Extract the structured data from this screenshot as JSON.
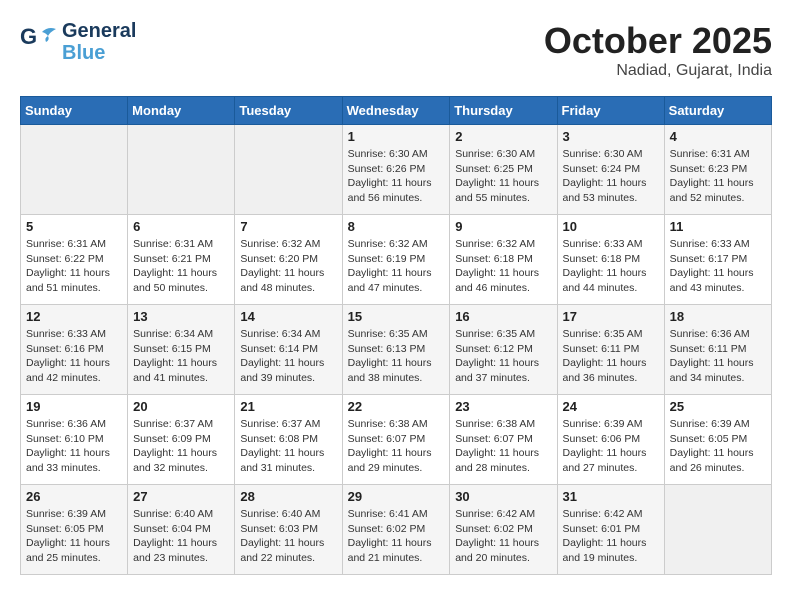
{
  "logo": {
    "line1": "General",
    "line2": "Blue"
  },
  "title": "October 2025",
  "location": "Nadiad, Gujarat, India",
  "days_of_week": [
    "Sunday",
    "Monday",
    "Tuesday",
    "Wednesday",
    "Thursday",
    "Friday",
    "Saturday"
  ],
  "weeks": [
    [
      {
        "day": "",
        "info": ""
      },
      {
        "day": "",
        "info": ""
      },
      {
        "day": "",
        "info": ""
      },
      {
        "day": "1",
        "info": "Sunrise: 6:30 AM\nSunset: 6:26 PM\nDaylight: 11 hours\nand 56 minutes."
      },
      {
        "day": "2",
        "info": "Sunrise: 6:30 AM\nSunset: 6:25 PM\nDaylight: 11 hours\nand 55 minutes."
      },
      {
        "day": "3",
        "info": "Sunrise: 6:30 AM\nSunset: 6:24 PM\nDaylight: 11 hours\nand 53 minutes."
      },
      {
        "day": "4",
        "info": "Sunrise: 6:31 AM\nSunset: 6:23 PM\nDaylight: 11 hours\nand 52 minutes."
      }
    ],
    [
      {
        "day": "5",
        "info": "Sunrise: 6:31 AM\nSunset: 6:22 PM\nDaylight: 11 hours\nand 51 minutes."
      },
      {
        "day": "6",
        "info": "Sunrise: 6:31 AM\nSunset: 6:21 PM\nDaylight: 11 hours\nand 50 minutes."
      },
      {
        "day": "7",
        "info": "Sunrise: 6:32 AM\nSunset: 6:20 PM\nDaylight: 11 hours\nand 48 minutes."
      },
      {
        "day": "8",
        "info": "Sunrise: 6:32 AM\nSunset: 6:19 PM\nDaylight: 11 hours\nand 47 minutes."
      },
      {
        "day": "9",
        "info": "Sunrise: 6:32 AM\nSunset: 6:18 PM\nDaylight: 11 hours\nand 46 minutes."
      },
      {
        "day": "10",
        "info": "Sunrise: 6:33 AM\nSunset: 6:18 PM\nDaylight: 11 hours\nand 44 minutes."
      },
      {
        "day": "11",
        "info": "Sunrise: 6:33 AM\nSunset: 6:17 PM\nDaylight: 11 hours\nand 43 minutes."
      }
    ],
    [
      {
        "day": "12",
        "info": "Sunrise: 6:33 AM\nSunset: 6:16 PM\nDaylight: 11 hours\nand 42 minutes."
      },
      {
        "day": "13",
        "info": "Sunrise: 6:34 AM\nSunset: 6:15 PM\nDaylight: 11 hours\nand 41 minutes."
      },
      {
        "day": "14",
        "info": "Sunrise: 6:34 AM\nSunset: 6:14 PM\nDaylight: 11 hours\nand 39 minutes."
      },
      {
        "day": "15",
        "info": "Sunrise: 6:35 AM\nSunset: 6:13 PM\nDaylight: 11 hours\nand 38 minutes."
      },
      {
        "day": "16",
        "info": "Sunrise: 6:35 AM\nSunset: 6:12 PM\nDaylight: 11 hours\nand 37 minutes."
      },
      {
        "day": "17",
        "info": "Sunrise: 6:35 AM\nSunset: 6:11 PM\nDaylight: 11 hours\nand 36 minutes."
      },
      {
        "day": "18",
        "info": "Sunrise: 6:36 AM\nSunset: 6:11 PM\nDaylight: 11 hours\nand 34 minutes."
      }
    ],
    [
      {
        "day": "19",
        "info": "Sunrise: 6:36 AM\nSunset: 6:10 PM\nDaylight: 11 hours\nand 33 minutes."
      },
      {
        "day": "20",
        "info": "Sunrise: 6:37 AM\nSunset: 6:09 PM\nDaylight: 11 hours\nand 32 minutes."
      },
      {
        "day": "21",
        "info": "Sunrise: 6:37 AM\nSunset: 6:08 PM\nDaylight: 11 hours\nand 31 minutes."
      },
      {
        "day": "22",
        "info": "Sunrise: 6:38 AM\nSunset: 6:07 PM\nDaylight: 11 hours\nand 29 minutes."
      },
      {
        "day": "23",
        "info": "Sunrise: 6:38 AM\nSunset: 6:07 PM\nDaylight: 11 hours\nand 28 minutes."
      },
      {
        "day": "24",
        "info": "Sunrise: 6:39 AM\nSunset: 6:06 PM\nDaylight: 11 hours\nand 27 minutes."
      },
      {
        "day": "25",
        "info": "Sunrise: 6:39 AM\nSunset: 6:05 PM\nDaylight: 11 hours\nand 26 minutes."
      }
    ],
    [
      {
        "day": "26",
        "info": "Sunrise: 6:39 AM\nSunset: 6:05 PM\nDaylight: 11 hours\nand 25 minutes."
      },
      {
        "day": "27",
        "info": "Sunrise: 6:40 AM\nSunset: 6:04 PM\nDaylight: 11 hours\nand 23 minutes."
      },
      {
        "day": "28",
        "info": "Sunrise: 6:40 AM\nSunset: 6:03 PM\nDaylight: 11 hours\nand 22 minutes."
      },
      {
        "day": "29",
        "info": "Sunrise: 6:41 AM\nSunset: 6:02 PM\nDaylight: 11 hours\nand 21 minutes."
      },
      {
        "day": "30",
        "info": "Sunrise: 6:42 AM\nSunset: 6:02 PM\nDaylight: 11 hours\nand 20 minutes."
      },
      {
        "day": "31",
        "info": "Sunrise: 6:42 AM\nSunset: 6:01 PM\nDaylight: 11 hours\nand 19 minutes."
      },
      {
        "day": "",
        "info": ""
      }
    ]
  ]
}
